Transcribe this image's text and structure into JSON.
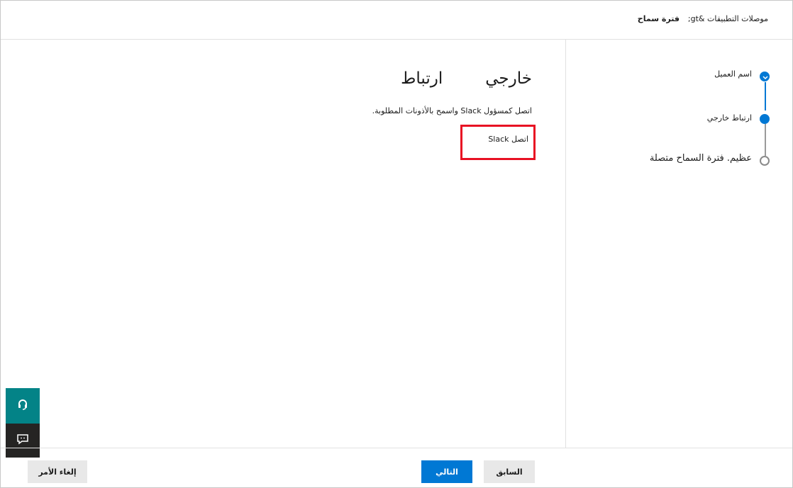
{
  "breadcrumb": {
    "parent": "موصلات التطبيقات &gt;",
    "current": "فترة سماح"
  },
  "steps": [
    {
      "label": "اسم العميل",
      "state": "complete"
    },
    {
      "label": "ارتباط خارجي",
      "state": "current"
    },
    {
      "label": "عظيم. فترة السماح متصلة",
      "state": "pending"
    }
  ],
  "main": {
    "title_part1": "خارجي",
    "title_part2": "ارتباط",
    "description": "اتصل كمسؤول Slack واسمح بالأذونات المطلوبة.",
    "connect_link": "اتصل Slack"
  },
  "side_buttons": {
    "support_icon": "headset-icon",
    "feedback_icon": "feedback-icon"
  },
  "footer": {
    "cancel_label": "إلغاء الأمر",
    "next_label": "التالي",
    "back_label": "السابق"
  },
  "colors": {
    "accent": "#0078d4",
    "highlight": "#e81123",
    "support": "#038387"
  }
}
